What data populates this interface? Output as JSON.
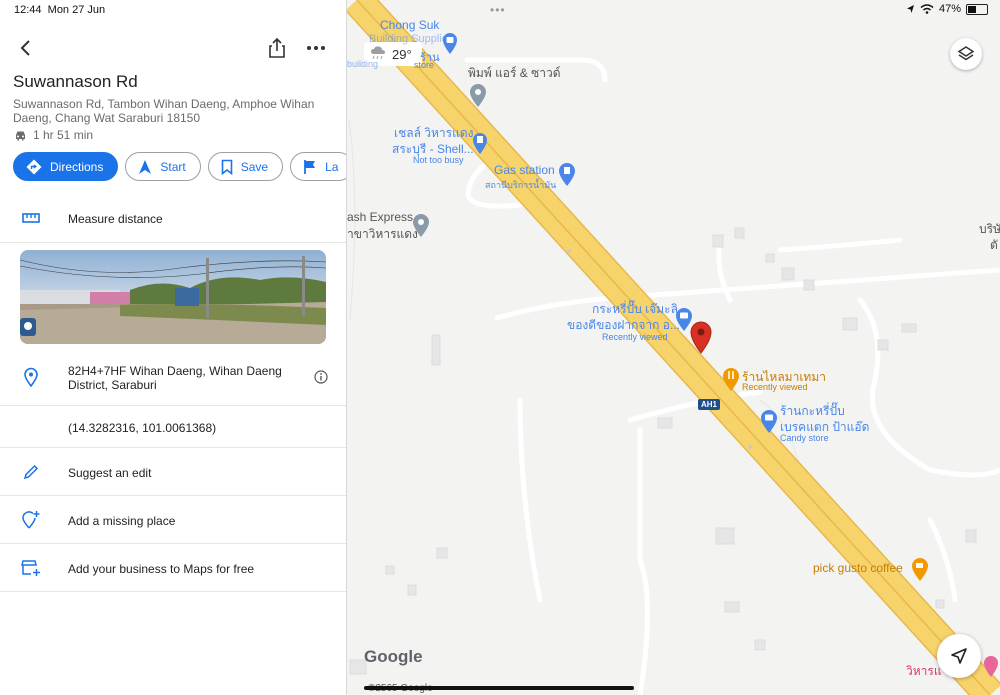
{
  "status_bar": {
    "time": "12:44",
    "date": "Mon 27 Jun",
    "battery": "47%"
  },
  "place": {
    "title": "Suwannason Rd",
    "address": "Suwannason Rd, Tambon Wihan Daeng, Amphoe Wihan Daeng, Chang Wat Saraburi 18150",
    "drive_time": "1 hr 51 min"
  },
  "actions": {
    "directions": "Directions",
    "start": "Start",
    "save": "Save",
    "label": "La"
  },
  "rows": {
    "measure": "Measure distance",
    "plus_code": "82H4+7HF Wihan Daeng, Wihan Daeng District, Saraburi",
    "coordinates": "(14.3282316, 101.0061368)",
    "suggest_edit": "Suggest an edit",
    "add_missing": "Add a missing place",
    "add_business": "Add your business to Maps for free"
  },
  "map": {
    "weather": "29°",
    "labels": {
      "chong_suk": "Chong Suk",
      "chong_suk_2": "Building Supplies",
      "chong_suk_3": "ร้าน",
      "chong_suk_4": "building",
      "chong_suk_5": "store",
      "phimphon": "พิมพ์ แอร์ & ซาวด์",
      "shell_1": "เชลล์ วิหารแดง",
      "shell_2": "สระบุรี - Shell...",
      "shell_3": "Not too busy",
      "gas": "Gas station",
      "gas_th": "สถานีบริการน้ำมัน",
      "flash_1": "ash Express",
      "flash_2": "าขาวิหารแดง",
      "kraprip_1": "กระหรี่ปั๊บ เจ๊มะลิ",
      "kraprip_2": "ของดีของฝากจาก อ...",
      "kraprip_3": "Recently viewed",
      "thai_1": "ร้านไหลมาเทมา",
      "thai_2": "Recently viewed",
      "candy_1": "ร้านกะหรี่ปั๊บ",
      "candy_2": "เบรคแตก ป้าแอ๊ด",
      "candy_3": "Candy store",
      "ah1": "AH1",
      "pick": "pick gusto coffee",
      "wihan": "วิหารแ",
      "right_1": "บริษั",
      "right_2": "ตั",
      "google": "Google",
      "copyright": "©2565 Google"
    }
  },
  "colors": {
    "accent": "#1a73e8",
    "road": "#f7d36b",
    "road_edge": "#e8b84a",
    "pin": "#d93025",
    "food": "#f29900",
    "shop": "#4a86e8"
  }
}
